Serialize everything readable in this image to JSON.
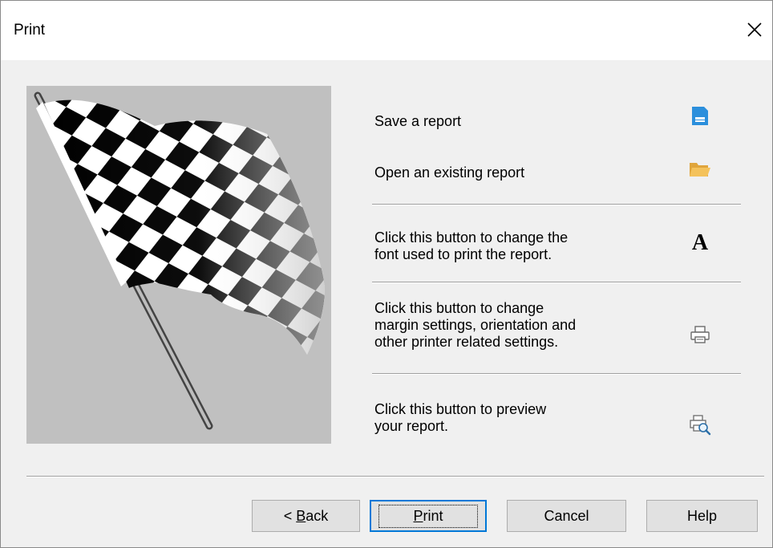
{
  "window": {
    "title": "Print"
  },
  "rows": [
    {
      "label": "Save a report",
      "icon": "save-icon"
    },
    {
      "label": "Open an existing report",
      "icon": "folder-open-icon"
    },
    {
      "label": "Click this button to change the\nfont used to print the report.",
      "icon": "font-icon"
    },
    {
      "label": "Click this button to change\nmargin settings, orientation and\nother printer related settings.",
      "icon": "printer-icon"
    },
    {
      "label": "Click this button to preview\nyour report.",
      "icon": "print-preview-icon"
    }
  ],
  "buttons": {
    "back_prefix": "< ",
    "back_mnemonic": "B",
    "back_rest": "ack",
    "print_mnemonic": "P",
    "print_rest": "rint",
    "cancel": "Cancel",
    "help": "Help"
  },
  "colors": {
    "accent": "#0078d7",
    "flag_bg": "#c0c0c0",
    "icon_blue": "#2c8fdc",
    "folder": "#f4c25b"
  }
}
